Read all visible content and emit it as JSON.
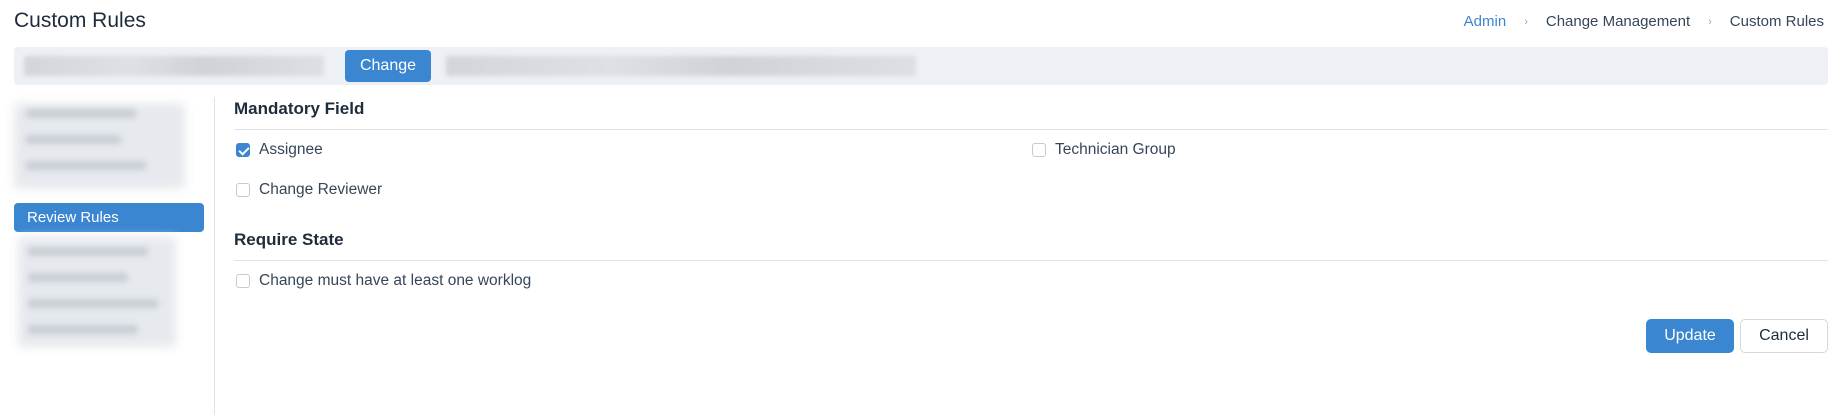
{
  "header": {
    "title": "Custom Rules",
    "breadcrumb": [
      "Admin",
      "Change Management",
      "Custom Rules"
    ],
    "separator": "›"
  },
  "toolbar": {
    "module_button": "Change"
  },
  "sidebar": {
    "active_item": "Review Rules"
  },
  "sections": {
    "mandatory": {
      "title": "Mandatory Field",
      "options": [
        {
          "label": "Assignee",
          "checked": true
        },
        {
          "label": "Technician Group",
          "checked": false
        },
        {
          "label": "Change Reviewer",
          "checked": false
        }
      ]
    },
    "require_state": {
      "title": "Require State",
      "options": [
        {
          "label": "Change must have at least one worklog",
          "checked": false
        }
      ]
    }
  },
  "actions": {
    "update": "Update",
    "cancel": "Cancel"
  },
  "colors": {
    "accent": "#3a86d1",
    "toolbar_bg": "#edf0f4"
  }
}
